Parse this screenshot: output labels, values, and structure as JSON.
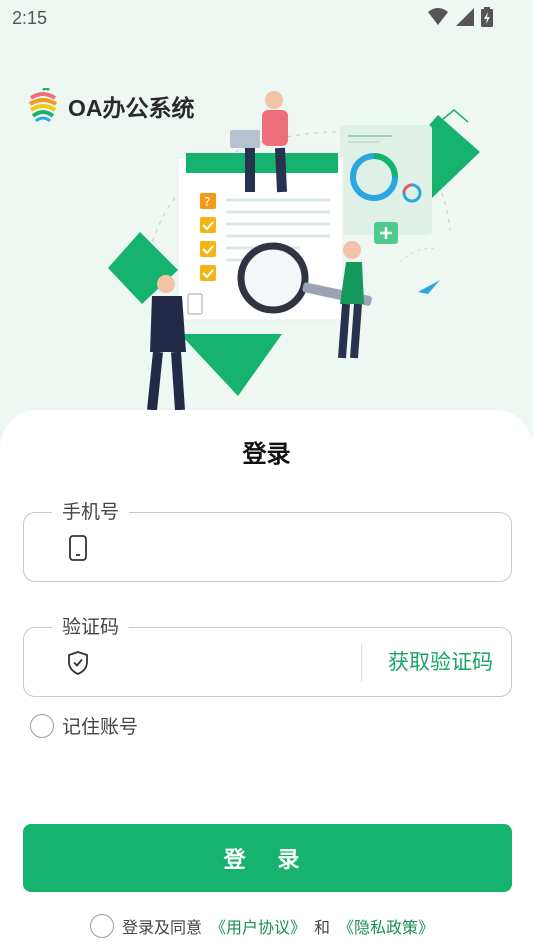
{
  "status": {
    "time": "2:15"
  },
  "brand": {
    "title": "OA办公系统"
  },
  "login": {
    "title": "登录",
    "phone_label": "手机号",
    "code_label": "验证码",
    "get_code": "获取验证码",
    "remember": "记住账号",
    "submit": "登 录"
  },
  "agreement": {
    "prefix": "登录及同意",
    "user_agreement": "《用户协议》",
    "and": "和",
    "privacy_policy": "《隐私政策》"
  },
  "colors": {
    "accent": "#16b36e",
    "link": "#1a8f55"
  },
  "icons": [
    "wifi-icon",
    "signal-icon",
    "battery-icon",
    "phone-icon",
    "shield-check-icon"
  ]
}
